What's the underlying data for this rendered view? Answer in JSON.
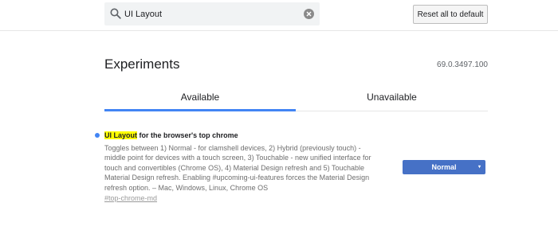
{
  "search": {
    "value": "UI Layout",
    "icon": "search-icon",
    "clear_icon": "close-icon"
  },
  "toolbar": {
    "reset_label": "Reset all to default"
  },
  "page": {
    "title": "Experiments",
    "version": "69.0.3497.100"
  },
  "tabs": [
    {
      "label": "Available",
      "active": true
    },
    {
      "label": "Unavailable",
      "active": false
    }
  ],
  "experiment": {
    "name_highlight": "UI Layout",
    "name_rest": " for the browser's top chrome",
    "description": "Toggles between 1) Normal - for clamshell devices, 2) Hybrid (previously touch) - middle point for devices with a touch screen, 3) Touchable - new unified interface for touch and convertibles (Chrome OS), 4) Material Design refresh and 5) Touchable Material Design refresh. Enabling #upcoming-ui-features forces the Material Design refresh option. – Mac, Windows, Linux, Chrome OS",
    "link": "#top-chrome-md",
    "select_value": "Normal",
    "select_arrow": "▾"
  },
  "colors": {
    "accent": "#4285f4",
    "select_bg": "#4671c6",
    "highlight": "#ffff00"
  }
}
